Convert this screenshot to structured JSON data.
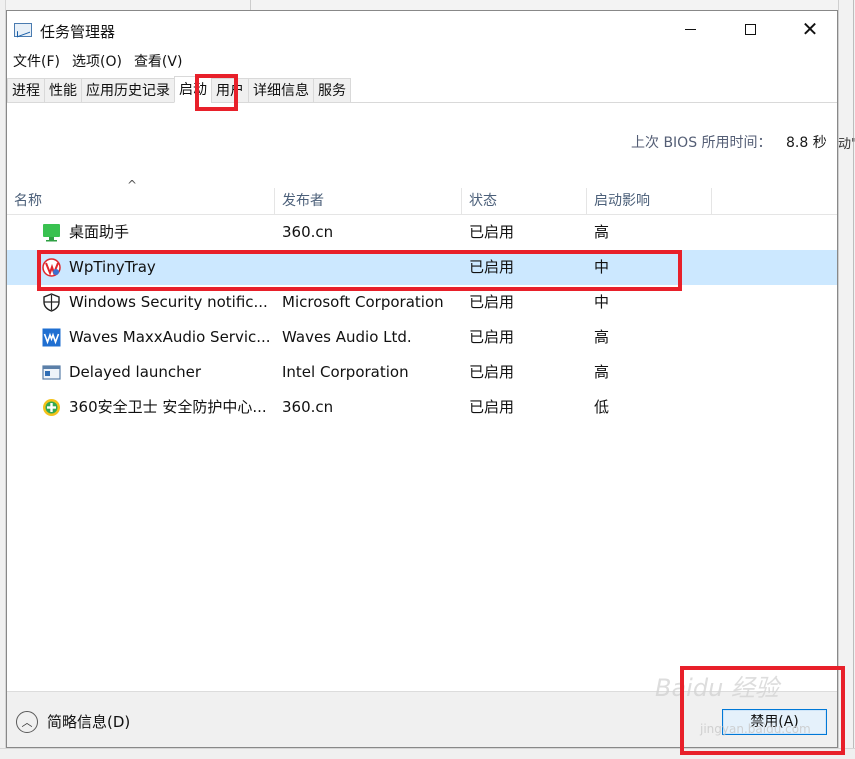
{
  "window": {
    "title": "任务管理器",
    "controls": {
      "minimize": "—",
      "maximize": "☐",
      "close": "✕"
    }
  },
  "menu": [
    {
      "label": "文件(F)"
    },
    {
      "label": "选项(O)"
    },
    {
      "label": "查看(V)"
    }
  ],
  "tabs": [
    {
      "label": "进程",
      "active": false
    },
    {
      "label": "性能",
      "active": false
    },
    {
      "label": "应用历史记录",
      "active": false
    },
    {
      "label": "启动",
      "active": true
    },
    {
      "label": "用户",
      "active": false
    },
    {
      "label": "详细信息",
      "active": false
    },
    {
      "label": "服务",
      "active": false
    }
  ],
  "bios": {
    "label": "上次 BIOS 所用时间：",
    "value": "8.8 秒"
  },
  "background_right_text": "动\"台",
  "table": {
    "sort_indicator": "^",
    "columns": [
      "名称",
      "发布者",
      "状态",
      "启动影响"
    ],
    "rows": [
      {
        "name": "桌面助手",
        "publisher": "360.cn",
        "status": "已启用",
        "impact": "高",
        "icon": "green-monitor-icon"
      },
      {
        "name": "WpTinyTray",
        "publisher": "",
        "status": "已启用",
        "impact": "中",
        "icon": "wps-tray-icon",
        "selected": true
      },
      {
        "name": "Windows Security notific...",
        "publisher": "Microsoft Corporation",
        "status": "已启用",
        "impact": "中",
        "icon": "shield-icon"
      },
      {
        "name": "Waves MaxxAudio Servic...",
        "publisher": "Waves Audio Ltd.",
        "status": "已启用",
        "impact": "高",
        "icon": "waves-audio-icon"
      },
      {
        "name": "Delayed launcher",
        "publisher": "Intel Corporation",
        "status": "已启用",
        "impact": "高",
        "icon": "app-window-icon"
      },
      {
        "name": "360安全卫士 安全防护中心...",
        "publisher": "360.cn",
        "status": "已启用",
        "impact": "低",
        "icon": "360-guard-icon"
      }
    ]
  },
  "footer": {
    "collapse_label": "简略信息(D)",
    "disable_button": "禁用(A)"
  },
  "watermark": {
    "text": "Baidu 经验",
    "url": "jingyan.baidu.com"
  },
  "colors": {
    "selected_row": "#cce8ff",
    "annotation": "#e8202a",
    "header_text": "#4c607a",
    "button_border": "#0078d7"
  }
}
